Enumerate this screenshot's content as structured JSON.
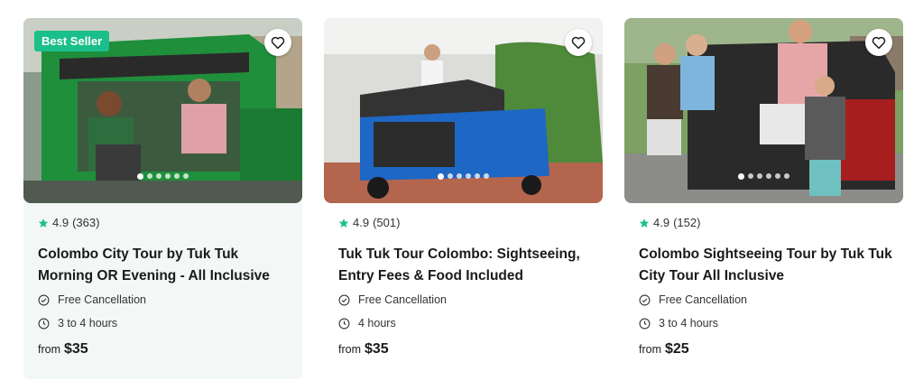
{
  "cards": [
    {
      "badge": "Best Seller",
      "rating": "4.9",
      "reviews": "(363)",
      "title": "Colombo City Tour by Tuk Tuk Morning OR Evening - All Inclusive",
      "feature1": "Free Cancellation",
      "feature2": "3 to 4 hours",
      "price_prefix": "from",
      "price": "$35"
    },
    {
      "rating": "4.9",
      "reviews": "(501)",
      "title": "Tuk Tuk Tour Colombo: Sightseeing, Entry Fees & Food Included",
      "feature1": "Free Cancellation",
      "feature2": "4 hours",
      "price_prefix": "from",
      "price": "$35"
    },
    {
      "rating": "4.9",
      "reviews": "(152)",
      "title": "Colombo Sightseeing Tour by Tuk Tuk City Tour All Inclusive",
      "feature1": "Free Cancellation",
      "feature2": "3 to 4 hours",
      "price_prefix": "from",
      "price": "$25"
    }
  ],
  "colors": {
    "accent": "#1bbf8a",
    "star": "#1bbf8a"
  },
  "icons": {
    "wishlist": "heart-outline-icon",
    "rating": "star-icon",
    "cancellation": "check-circle-icon",
    "duration": "clock-icon"
  }
}
